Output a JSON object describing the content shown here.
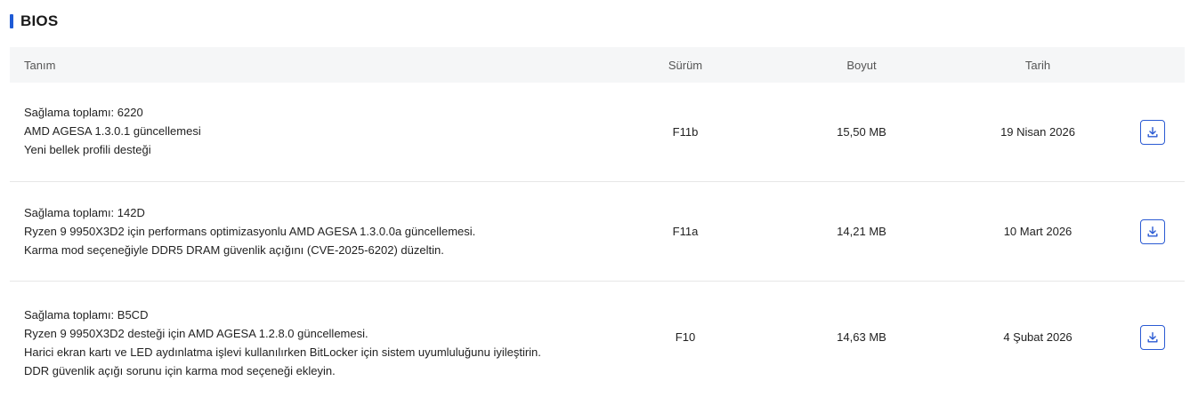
{
  "section": {
    "title": "BIOS"
  },
  "table": {
    "headers": {
      "description": "Tanım",
      "version": "Sürüm",
      "size": "Boyut",
      "date": "Tarih"
    },
    "rows": [
      {
        "lines": [
          "Sağlama toplamı: 6220",
          "AMD AGESA 1.3.0.1 güncellemesi",
          "Yeni bellek profili desteği"
        ],
        "version": "F11b",
        "size": "15,50 MB",
        "date": "19 Nisan 2026"
      },
      {
        "lines": [
          "Sağlama toplamı: 142D",
          "Ryzen 9 9950X3D2 için performans optimizasyonlu AMD AGESA 1.3.0.0a güncellemesi.",
          "Karma mod seçeneğiyle DDR5 DRAM güvenlik açığını (CVE-2025-6202) düzeltin."
        ],
        "version": "F11a",
        "size": "14,21 MB",
        "date": "10 Mart 2026"
      },
      {
        "lines": [
          "Sağlama toplamı: B5CD",
          "Ryzen 9 9950X3D2 desteği için AMD AGESA 1.2.8.0 güncellemesi.",
          "Harici ekran kartı ve LED aydınlatma işlevi kullanılırken BitLocker için sistem uyumluluğunu iyileştirin.",
          "DDR güvenlik açığı sorunu için karma mod seçeneği ekleyin."
        ],
        "version": "F10",
        "size": "14,63 MB",
        "date": "4 Şubat 2026"
      }
    ]
  },
  "icons": {
    "download": "download-icon"
  },
  "colors": {
    "accent": "#1f5bd6",
    "header_bg": "#f5f6f7",
    "border": "#e6e6e6"
  }
}
